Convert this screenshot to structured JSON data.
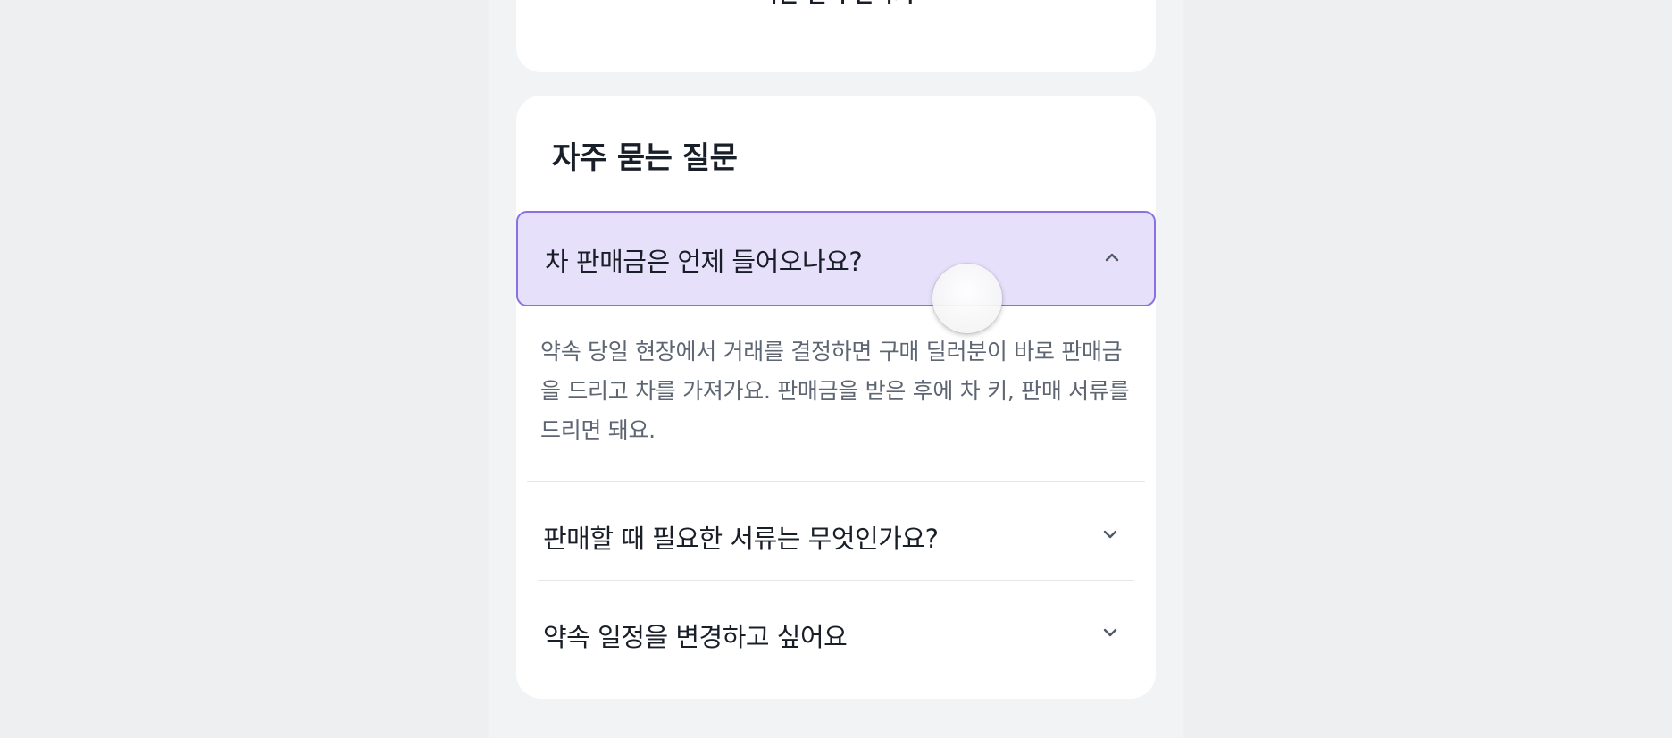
{
  "top_card": {
    "button_label": "다른 딜러 만나기"
  },
  "faq": {
    "title": "자주 묻는 질문",
    "items": [
      {
        "question": "차 판매금은 언제 들어오나요?",
        "expanded": true,
        "answer": "약속 당일 현장에서 거래를 결정하면 구매 딜러분이 바로 판매금을 드리고 차를 가져가요. 판매금을 받은 후에 차 키, 판매 서류를 드리면 돼요.",
        "icon": "chevron-up-icon"
      },
      {
        "question": "판매할 때 필요한 서류는 무엇인가요?",
        "expanded": false,
        "icon": "chevron-down-icon"
      },
      {
        "question": "약속 일정을 변경하고 싶어요",
        "expanded": false,
        "icon": "chevron-down-icon"
      }
    ]
  },
  "colors": {
    "accent_border": "#8a70e0",
    "accent_bg": "#e6e0fa",
    "text_primary": "#191f28",
    "text_secondary": "#5e6673"
  }
}
